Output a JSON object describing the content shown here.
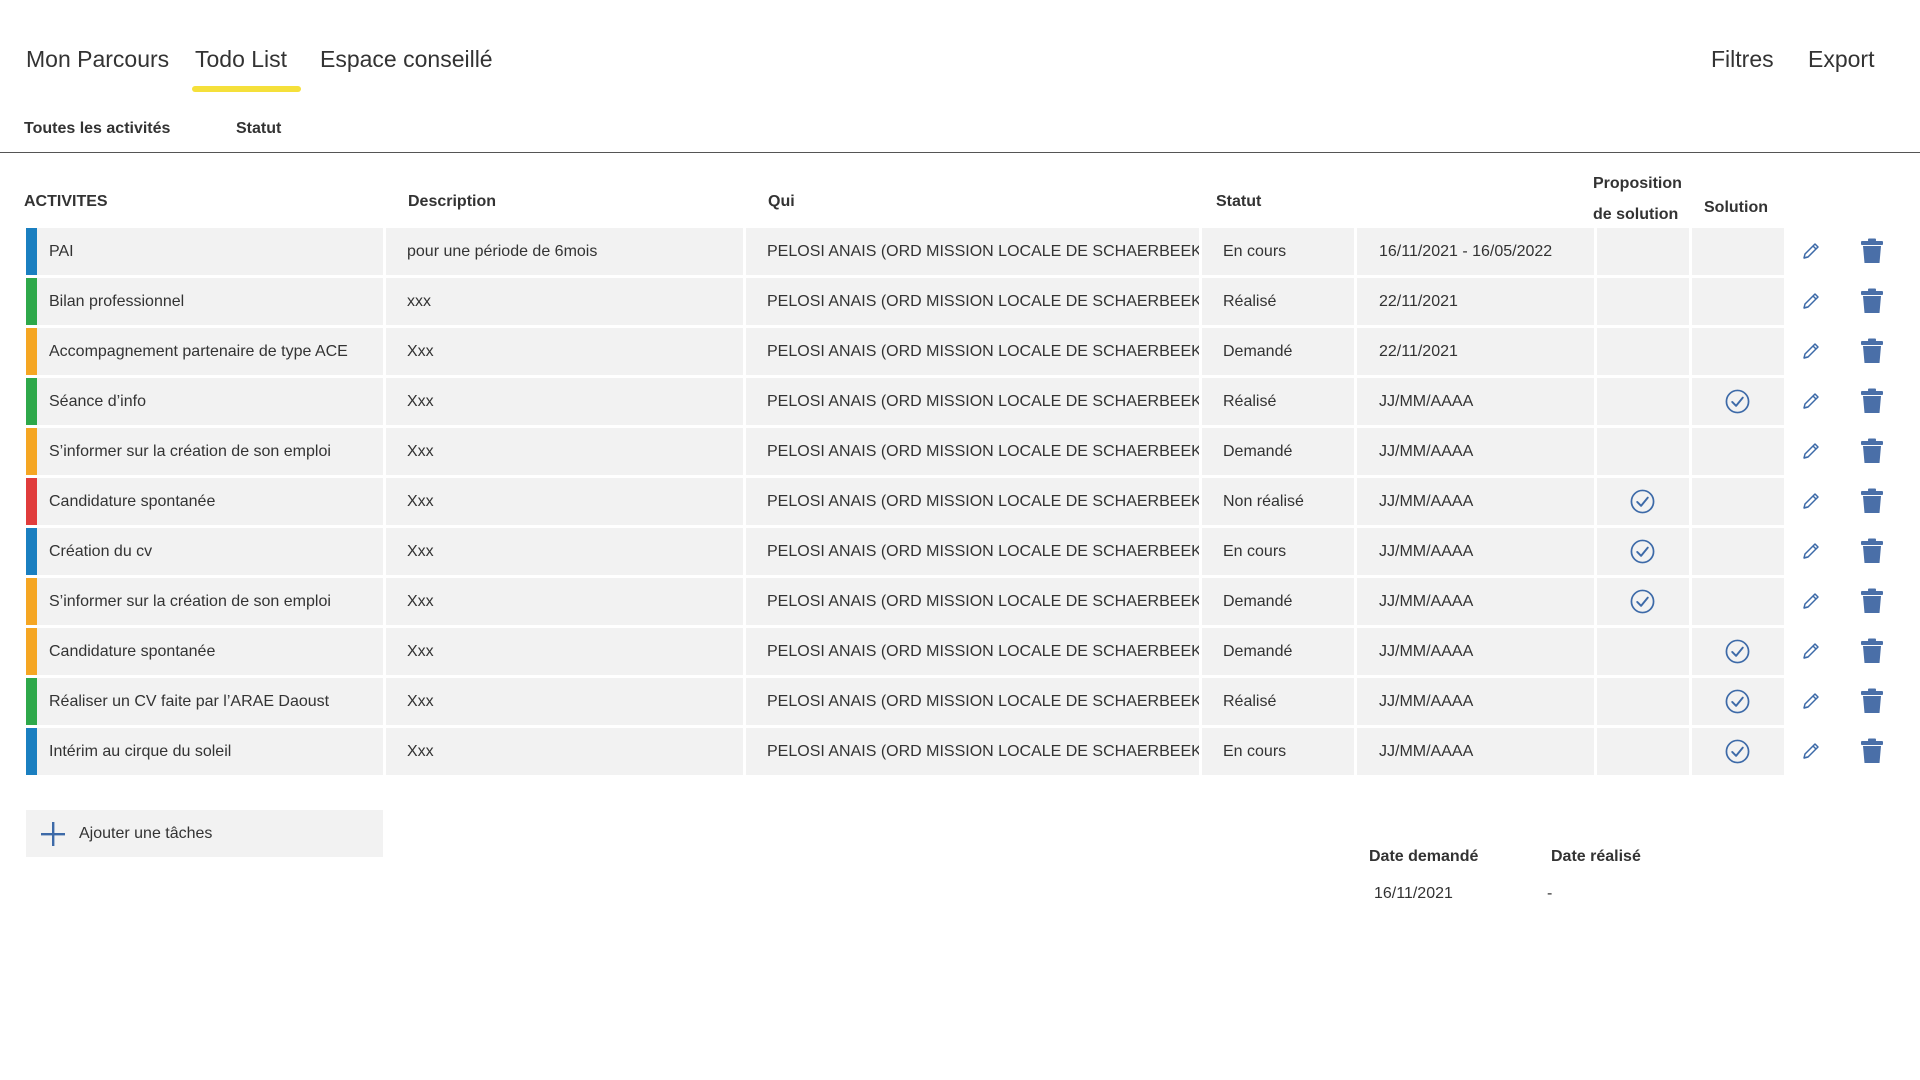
{
  "nav": {
    "tabs": [
      {
        "label": "Mon Parcours"
      },
      {
        "label": "Todo List"
      },
      {
        "label": "Espace conseillé"
      }
    ],
    "right": {
      "filters": "Filtres",
      "export": "Export"
    }
  },
  "subnav": {
    "all": "Toutes les activités",
    "status": "Statut"
  },
  "table": {
    "headers": {
      "activites": "ACTIVITES",
      "description": "Description",
      "qui": "Qui",
      "statut": "Statut",
      "proposition": "Proposition de solution",
      "solution": "Solution"
    },
    "rows": [
      {
        "color": "#1a7fc0",
        "activity": "PAI",
        "description": "pour une période de 6mois",
        "who": "PELOSI ANAIS (ORD MISSION LOCALE DE SCHAERBEEK)",
        "status": "En cours",
        "date": "16/11/2021 - 16/05/2022",
        "proposition": false,
        "solution": false
      },
      {
        "color": "#2ea84a",
        "activity": "Bilan professionnel",
        "description": "xxx",
        "who": "PELOSI ANAIS (ORD MISSION LOCALE DE SCHAERBEEK)",
        "status": "Réalisé",
        "date": "22/11/2021",
        "proposition": false,
        "solution": false
      },
      {
        "color": "#f5a623",
        "activity": "Accompagnement partenaire de type ACE",
        "description": "Xxx",
        "who": "PELOSI ANAIS (ORD MISSION LOCALE DE SCHAERBEEK)",
        "status": "Demandé",
        "date": "22/11/2021",
        "proposition": false,
        "solution": false
      },
      {
        "color": "#2ea84a",
        "activity": "Séance d’info",
        "description": "Xxx",
        "who": "PELOSI ANAIS (ORD MISSION LOCALE DE SCHAERBEEK)",
        "status": "Réalisé",
        "date": "JJ/MM/AAAA",
        "proposition": false,
        "solution": true
      },
      {
        "color": "#f5a623",
        "activity": "S’informer sur la création de son emploi",
        "description": "Xxx",
        "who": "PELOSI ANAIS (ORD MISSION LOCALE DE SCHAERBEEK)",
        "status": "Demandé",
        "date": "JJ/MM/AAAA",
        "proposition": false,
        "solution": false
      },
      {
        "color": "#e03c3c",
        "activity": "Candidature spontanée",
        "description": "Xxx",
        "who": "PELOSI ANAIS (ORD MISSION LOCALE DE SCHAERBEEK)",
        "status": "Non réalisé",
        "date": "JJ/MM/AAAA",
        "proposition": true,
        "solution": false
      },
      {
        "color": "#1a7fc0",
        "activity": "Création du cv",
        "description": "Xxx",
        "who": "PELOSI ANAIS (ORD MISSION LOCALE DE SCHAERBEEK)",
        "status": "En cours",
        "date": "JJ/MM/AAAA",
        "proposition": true,
        "solution": false
      },
      {
        "color": "#f5a623",
        "activity": "S’informer sur la création de son emploi",
        "description": "Xxx",
        "who": "PELOSI ANAIS (ORD MISSION LOCALE DE SCHAERBEEK)",
        "status": "Demandé",
        "date": "JJ/MM/AAAA",
        "proposition": true,
        "solution": false
      },
      {
        "color": "#f5a623",
        "activity": "Candidature spontanée",
        "description": "Xxx",
        "who": "PELOSI ANAIS (ORD MISSION LOCALE DE SCHAERBEEK)",
        "status": "Demandé",
        "date": "JJ/MM/AAAA",
        "proposition": false,
        "solution": true
      },
      {
        "color": "#2ea84a",
        "activity": "Réaliser un CV  faite par l’ARAE Daoust",
        "description": "Xxx",
        "who": "PELOSI ANAIS (ORD MISSION LOCALE DE SCHAERBEEK)",
        "status": "Réalisé",
        "date": "JJ/MM/AAAA",
        "proposition": false,
        "solution": true
      },
      {
        "color": "#1a7fc0",
        "activity": "Intérim au cirque du soleil",
        "description": "Xxx",
        "who": "PELOSI ANAIS (ORD MISSION LOCALE DE SCHAERBEEK)",
        "status": "En cours",
        "date": "JJ/MM/AAAA",
        "proposition": false,
        "solution": true
      }
    ]
  },
  "add_task": {
    "label": "Ajouter une tâches",
    "icon": "plus-icon"
  },
  "date_detail": {
    "requested_label": "Date demandé",
    "done_label": "Date réalisé",
    "requested_value": "16/11/2021",
    "done_value": "-"
  },
  "colors": {
    "accent_underline": "#f5e03a",
    "icon_blue": "#3d6aa8",
    "trash_blue": "#4a6fa8"
  },
  "icons": {
    "edit": "pencil-icon",
    "delete": "trash-icon",
    "check": "check-circle-icon"
  }
}
